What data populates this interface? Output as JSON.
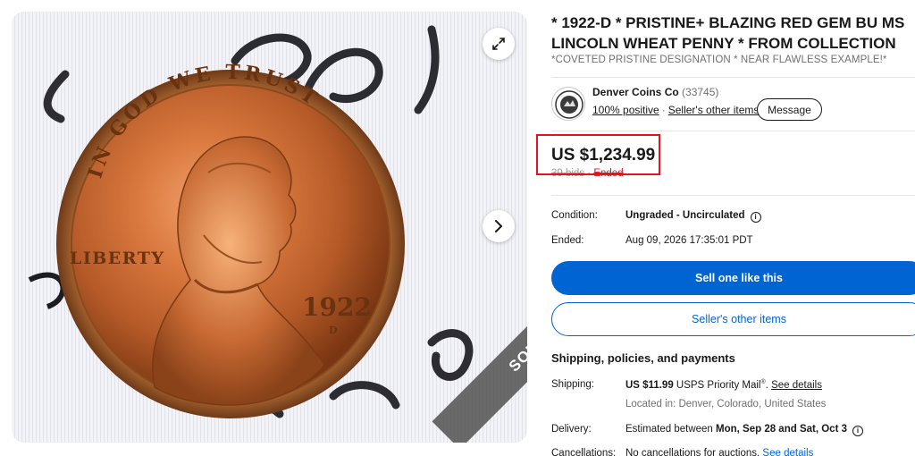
{
  "gallery": {
    "badge": "SOLD",
    "expand_icon": "expand-icon",
    "next_icon": "chevron-right-icon",
    "coin_text": {
      "top": "IN GOD WE TRUST",
      "left": "LIBERTY",
      "year": "1922",
      "mint": "D"
    }
  },
  "listing": {
    "title": "* 1922-D * PRISTINE+ BLAZING RED GEM BU MS LINCOLN WHEAT PENNY * FROM COLLECTION",
    "subtitle": "*COVETED PRISTINE DESIGNATION * NEAR FLAWLESS EXAMPLE!*"
  },
  "seller": {
    "name": "Denver Coins Co",
    "feedback_count": "(33745)",
    "positive": "100% positive",
    "other_items": "Seller's other items",
    "message": "Message",
    "logo_text": "DENVER COINS"
  },
  "price": {
    "amount": "US $1,234.99",
    "bids": "39 bids",
    "separator": "·",
    "status": "Ended",
    "highlight_color": "#e3141b"
  },
  "details": {
    "condition_label": "Condition:",
    "condition_value": "Ungraded - Uncirculated",
    "ended_label": "Ended:",
    "ended_value": "Aug 09, 2026 17:35:01 PDT"
  },
  "actions": {
    "sell_one": "Sell one like this",
    "sellers_other": "Seller's other items",
    "primary_color": "#0064d2"
  },
  "shipping": {
    "section_title": "Shipping, policies, and payments",
    "shipping_label": "Shipping:",
    "shipping_price": "US $11.99",
    "shipping_method": " USPS Priority Mail",
    "registered": "®",
    "see_details": "See details",
    "located_in": "Located in: Denver, Colorado, United States",
    "delivery_label": "Delivery:",
    "delivery_prefix": "Estimated between ",
    "delivery_dates": "Mon, Sep 28 and Sat, Oct 3",
    "cancellations_label": "Cancellations:",
    "cancellations_value": "No cancellations for auctions.",
    "cancellations_see": "See details"
  }
}
